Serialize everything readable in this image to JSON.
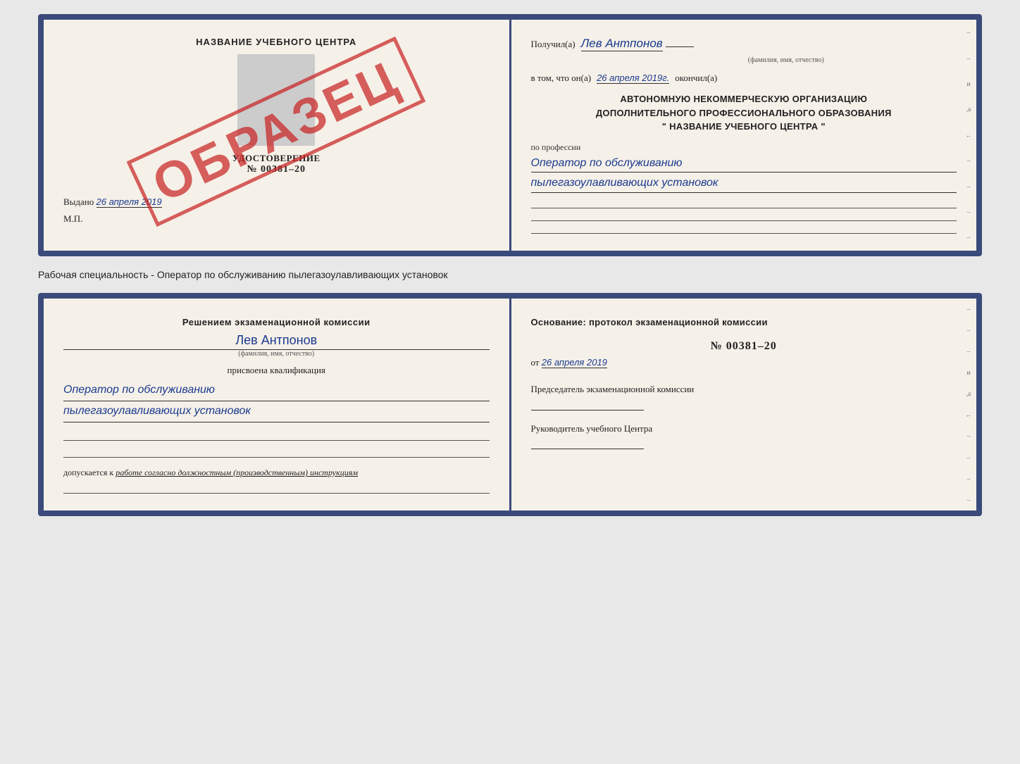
{
  "top_cert": {
    "left": {
      "title": "НАЗВАНИЕ УЧЕБНОГО ЦЕНТРА",
      "doc_type": "УДОСТОВЕРЕНИЕ",
      "doc_number": "№ 00381–20",
      "issued_label": "Выдано",
      "issued_date": "26 апреля 2019",
      "mp_label": "М.П.",
      "watermark": "ОБРАЗЕЦ"
    },
    "right": {
      "received_label": "Получил(а)",
      "received_name": "Лев Антпонов",
      "fio_sub": "(фамилия, имя, отчество)",
      "in_that_label": "в том, что он(а)",
      "date_completed": "26 апреля 2019г.",
      "completed_label": "окончил(а)",
      "org_line1": "АВТОНОМНУЮ НЕКОММЕРЧЕСКУЮ ОРГАНИЗАЦИЮ",
      "org_line2": "ДОПОЛНИТЕЛЬНОГО ПРОФЕССИОНАЛЬНОГО ОБРАЗОВАНИЯ",
      "org_line3": "\"   НАЗВАНИЕ УЧЕБНОГО ЦЕНТРА   \"",
      "profession_label": "по профессии",
      "profession_line1": "Оператор по обслуживанию",
      "profession_line2": "пылегазоулавливающих установок"
    }
  },
  "specialty_line": "Рабочая специальность - Оператор по обслуживанию пылегазоулавливающих установок",
  "bottom_cert": {
    "left": {
      "decision_label": "Решением экзаменационной комиссии",
      "name": "Лев Антпонов",
      "fio_sub": "(фамилия, имя, отчество)",
      "assigned_label": "присвоена квалификация",
      "profession_line1": "Оператор по обслуживанию",
      "profession_line2": "пылегазоулавливающих установок",
      "allowed_label": "допускается к",
      "allowed_value": "работе согласно должностным (производственным) инструкциям"
    },
    "right": {
      "basis_label": "Основание: протокол экзаменационной комиссии",
      "protocol_number": "№  00381–20",
      "date_prefix": "от",
      "date_value": "26 апреля 2019",
      "commission_chair_label": "Председатель экзаменационной комиссии",
      "director_label": "Руководитель учебного Центра"
    }
  }
}
